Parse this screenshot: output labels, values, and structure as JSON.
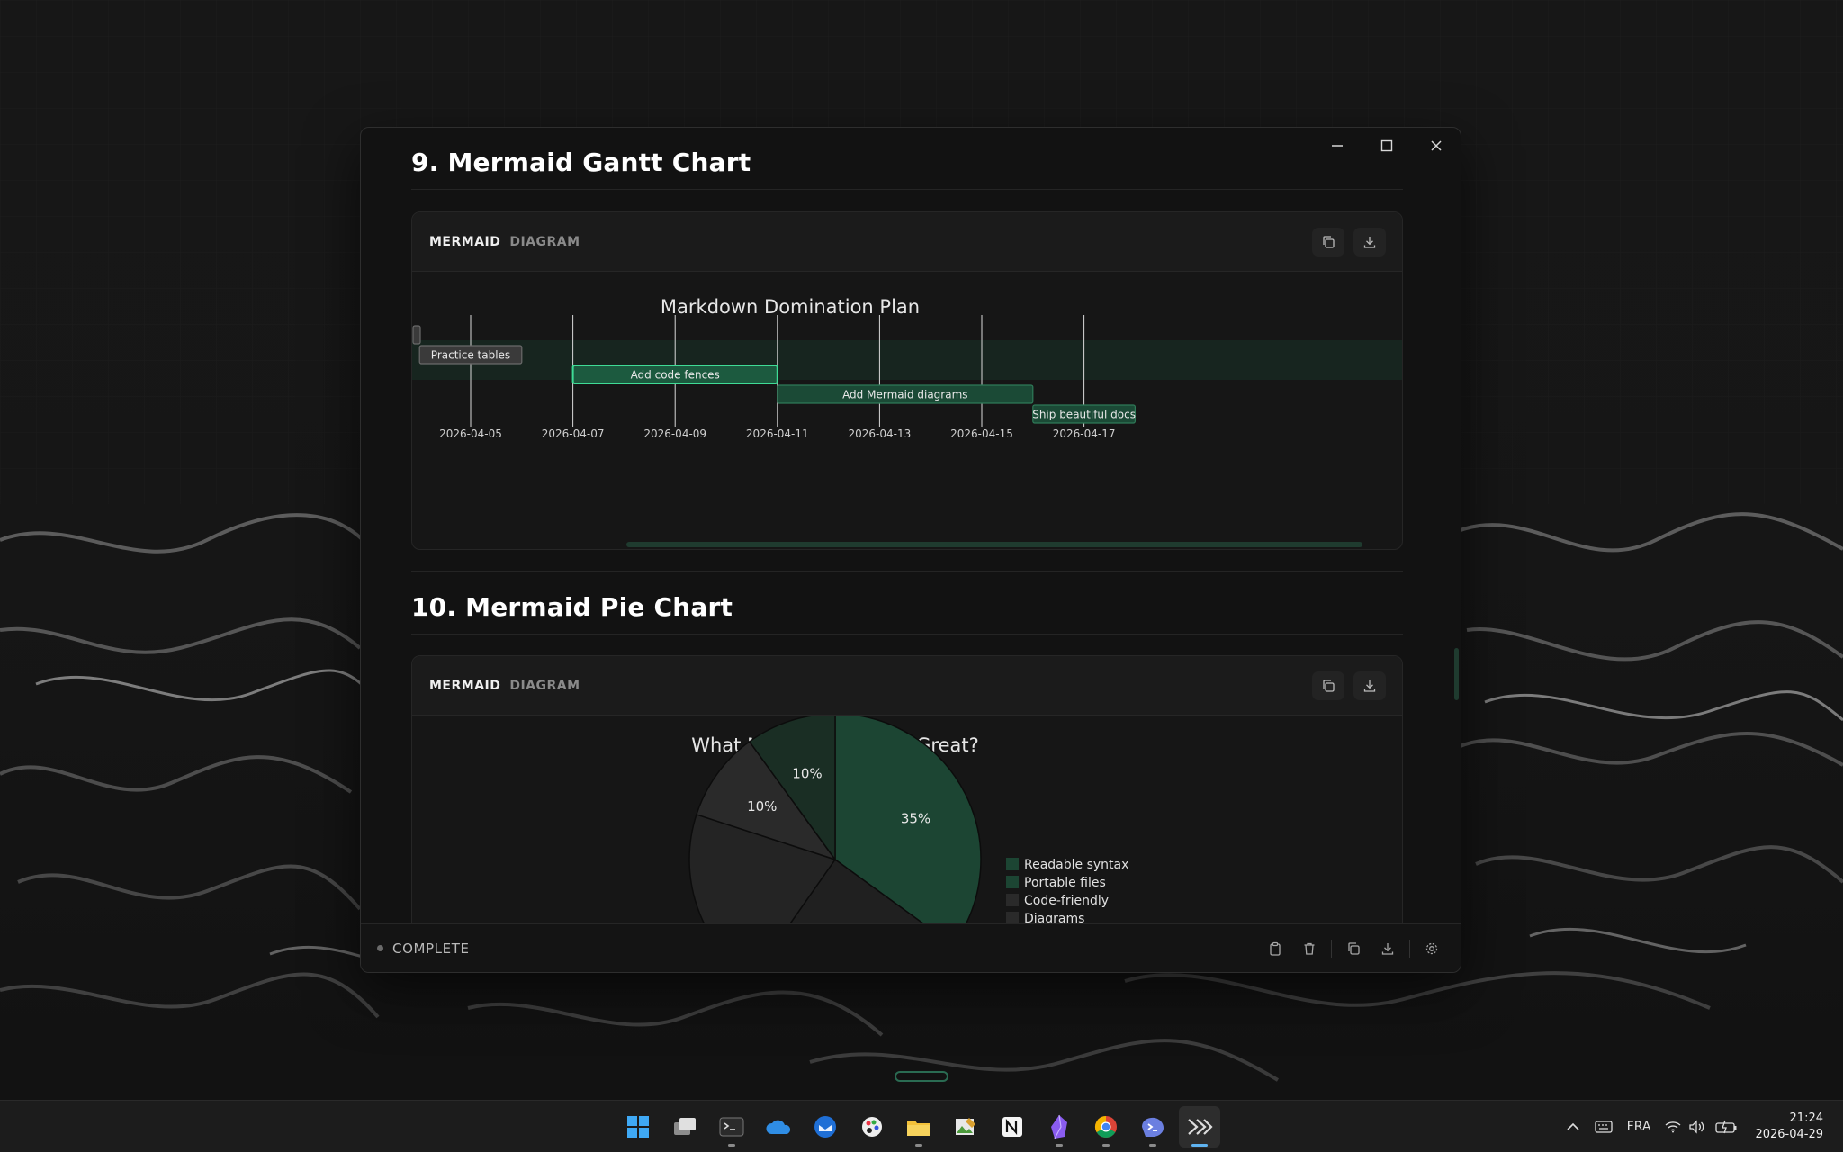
{
  "window": {
    "controls": {
      "minimize": "—",
      "maximize": "☐",
      "close": "✕"
    }
  },
  "sections": [
    {
      "title": "9. Mermaid Gantt Chart",
      "card": {
        "lang": "MERMAID",
        "kind": "DIAGRAM"
      }
    },
    {
      "title": "10. Mermaid Pie Chart",
      "card": {
        "lang": "MERMAID",
        "kind": "DIAGRAM"
      }
    }
  ],
  "card_actions": {
    "copy_icon": "copy-icon",
    "download_icon": "download-icon"
  },
  "chart_data": [
    {
      "type": "gantt",
      "title": "Markdown Domination Plan",
      "x_tick_labels": [
        "2026-04-05",
        "2026-04-07",
        "2026-04-09",
        "2026-04-11",
        "2026-04-13",
        "2026-04-15",
        "2026-04-17"
      ],
      "tasks": [
        {
          "name": "",
          "start": "2026-04-03",
          "end": "2026-04-04",
          "state": "done"
        },
        {
          "name": "Practice tables",
          "start": "2026-04-04",
          "end": "2026-04-06",
          "state": "done"
        },
        {
          "name": "Add code fences",
          "start": "2026-04-07",
          "end": "2026-04-11",
          "state": "active"
        },
        {
          "name": "Add Mermaid diagrams",
          "start": "2026-04-11",
          "end": "2026-04-16",
          "state": "normal"
        },
        {
          "name": "Ship beautiful docs",
          "start": "2026-04-16",
          "end": "2026-04-18",
          "state": "normal"
        }
      ],
      "colors": {
        "done": "#3a3a3a",
        "active": "#1c5a3f",
        "active_border": "#3fdc96",
        "normal": "#1b4a36",
        "normal_border": "#2f7a58"
      }
    },
    {
      "type": "pie",
      "title": "What Makes Markdown Great?",
      "slice_labels": [
        "35%",
        "10%",
        "10%"
      ],
      "legend": [
        "Readable syntax",
        "Portable files",
        "Code-friendly",
        "Diagrams"
      ],
      "colors": [
        "#1c4533",
        "#1a2e24",
        "#2a2a2a",
        "#202020",
        "#242424"
      ]
    }
  ],
  "status": {
    "label": "COMPLETE"
  },
  "taskbar": {
    "apps": [
      "windows-start-icon",
      "task-view-icon",
      "terminal-icon",
      "onedrive-icon",
      "thunderbird-icon",
      "paint-icon",
      "file-explorer-icon",
      "image-editor-icon",
      "notion-icon",
      "obsidian-icon",
      "chrome-icon",
      "powershell-icon",
      "markdown-app-icon"
    ],
    "language": "FRA",
    "time": "21:24",
    "date": "2026-04-29"
  }
}
